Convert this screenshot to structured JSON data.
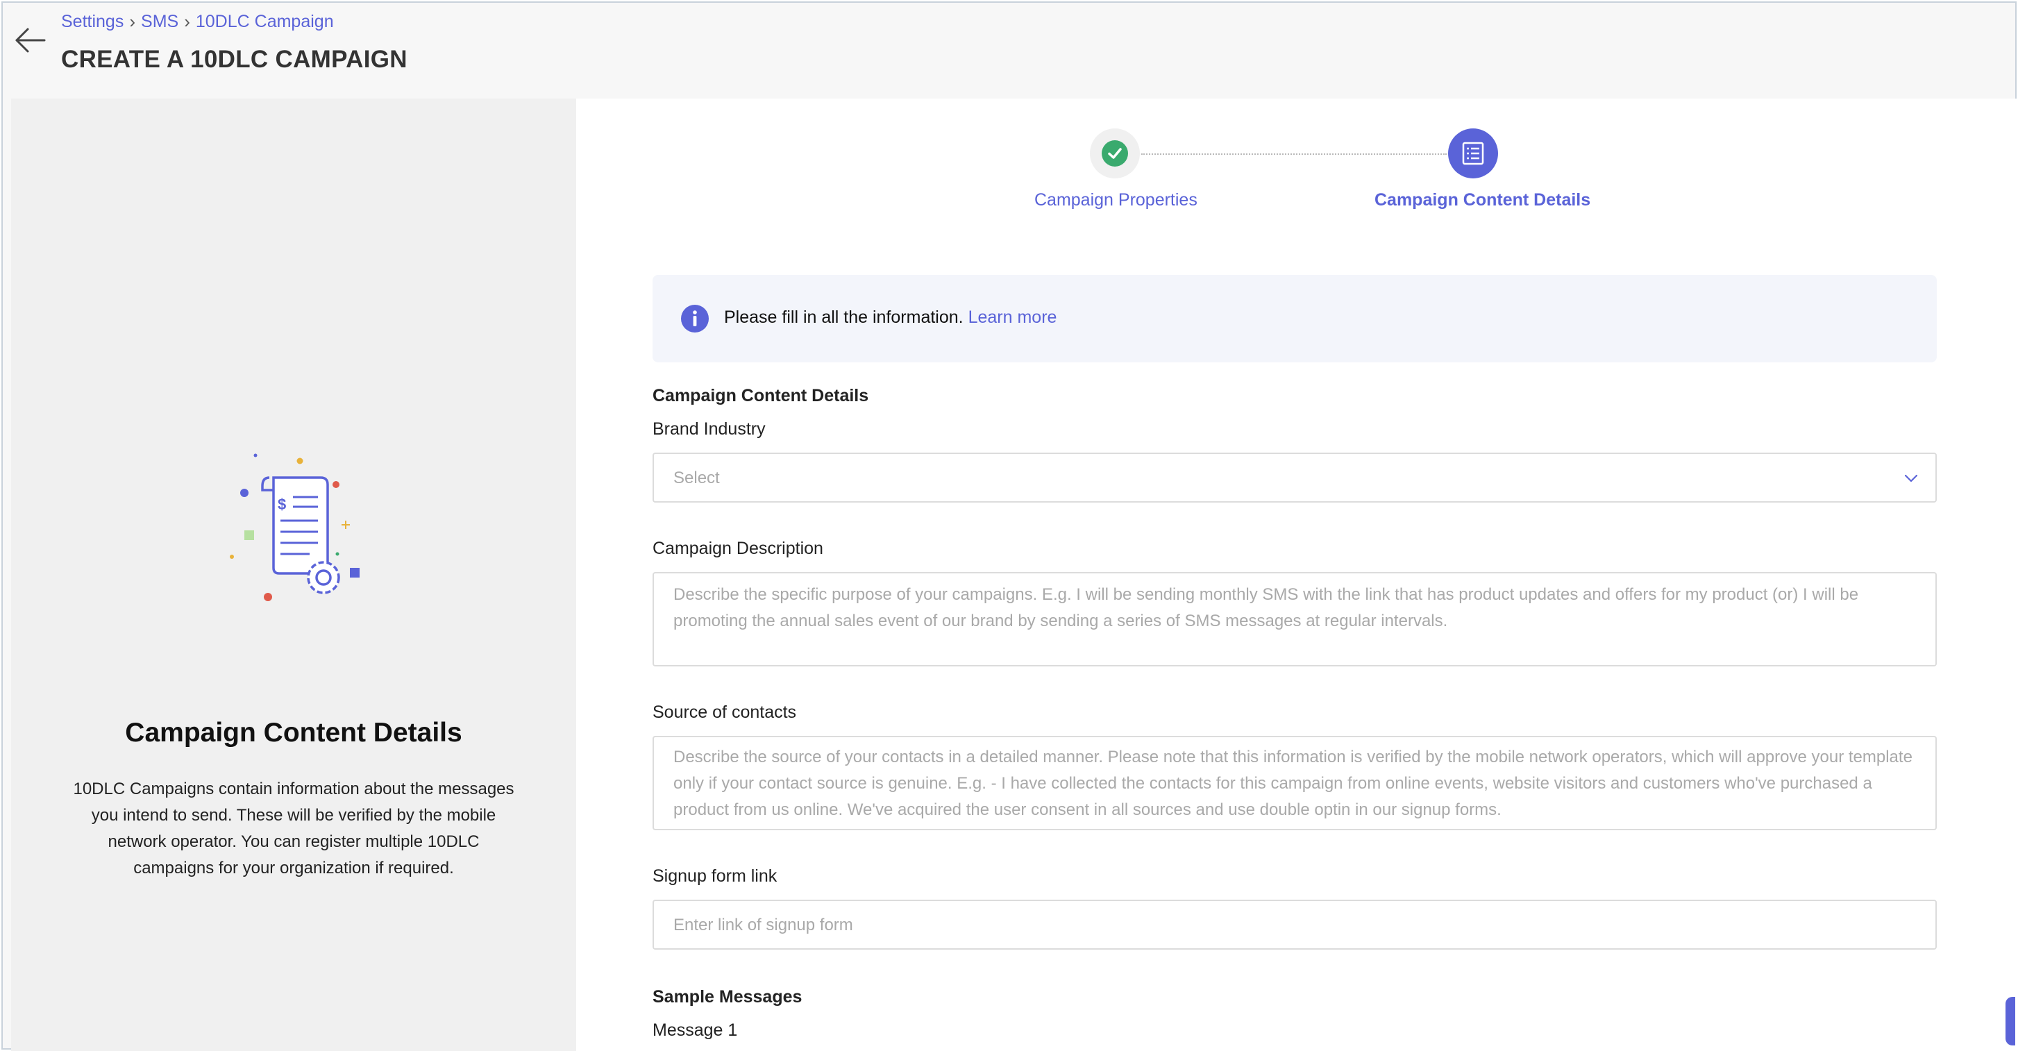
{
  "header": {
    "breadcrumb": [
      "Settings",
      "SMS",
      "10DLC Campaign"
    ],
    "breadcrumb_separator": "›",
    "title": "CREATE A 10DLC CAMPAIGN"
  },
  "left_panel": {
    "title": "Campaign Content Details",
    "description": "10DLC Campaigns contain information about the messages you intend to send. These will be verified by the mobile network operator. You can register multiple 10DLC campaigns for your organization if required.",
    "illustration_symbol": "$"
  },
  "stepper": {
    "steps": [
      {
        "label": "Campaign Properties",
        "state": "completed",
        "icon": "check-icon"
      },
      {
        "label": "Campaign Content Details",
        "state": "active",
        "icon": "list-icon"
      }
    ]
  },
  "info": {
    "text": "Please fill in all the information.",
    "link": "Learn more",
    "icon": "info-icon"
  },
  "form": {
    "section_title": "Campaign Content Details",
    "brand_industry": {
      "label": "Brand Industry",
      "placeholder": "Select"
    },
    "campaign_description": {
      "label": "Campaign Description",
      "placeholder": "Describe the specific purpose of your campaigns. E.g. I will be sending monthly SMS with the link that has product updates and offers for my product (or) I will be promoting the annual sales event of our brand by sending a series of SMS messages at regular intervals."
    },
    "source_of_contacts": {
      "label": "Source of contacts",
      "placeholder": "Describe the source of your contacts in a detailed manner. Please note that this information is verified by the mobile network operators, which will approve your template only if your contact source is genuine. E.g. - I have collected the contacts for this campaign from online events, website visitors and customers who've purchased a product from us online. We've acquired the user consent in all sources and use double optin in our signup forms."
    },
    "signup_form_link": {
      "label": "Signup form link",
      "placeholder": "Enter link of signup form"
    },
    "sample_messages": {
      "title": "Sample Messages",
      "message_1_label": "Message 1"
    }
  },
  "colors": {
    "accent": "#5a63d8",
    "success": "#3aaa6e",
    "left_panel_bg": "#f0f0f0",
    "info_bg": "#f3f5fb"
  }
}
